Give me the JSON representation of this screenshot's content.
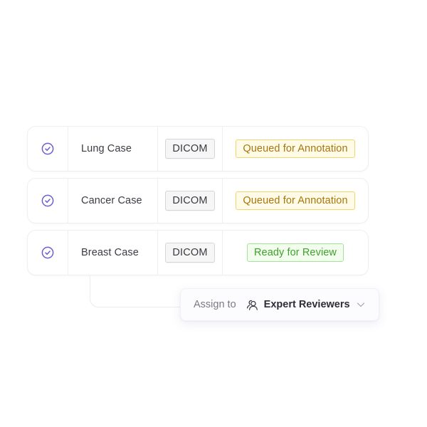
{
  "cases": [
    {
      "name": "Lung Case",
      "checked": true,
      "type": "DICOM",
      "status": "Queued for Annotation",
      "status_kind": "queued"
    },
    {
      "name": "Cancer Case",
      "checked": true,
      "type": "DICOM",
      "status": "Queued for Annotation",
      "status_kind": "queued"
    },
    {
      "name": "Breast Case",
      "checked": true,
      "type": "DICOM",
      "status": "Ready for Review",
      "status_kind": "ready"
    }
  ],
  "assign": {
    "label": "Assign to",
    "value": "Expert Reviewers",
    "icon": "users-icon",
    "dropdown_icon": "chevron-down-icon"
  },
  "colors": {
    "check_accent": "#6a5fd0",
    "queued_text": "#a8760c",
    "queued_bg": "#fffbe6",
    "queued_border": "#f3d36b",
    "ready_text": "#3ea02b",
    "ready_bg": "#f3fdee",
    "ready_border": "#a6e39a"
  }
}
